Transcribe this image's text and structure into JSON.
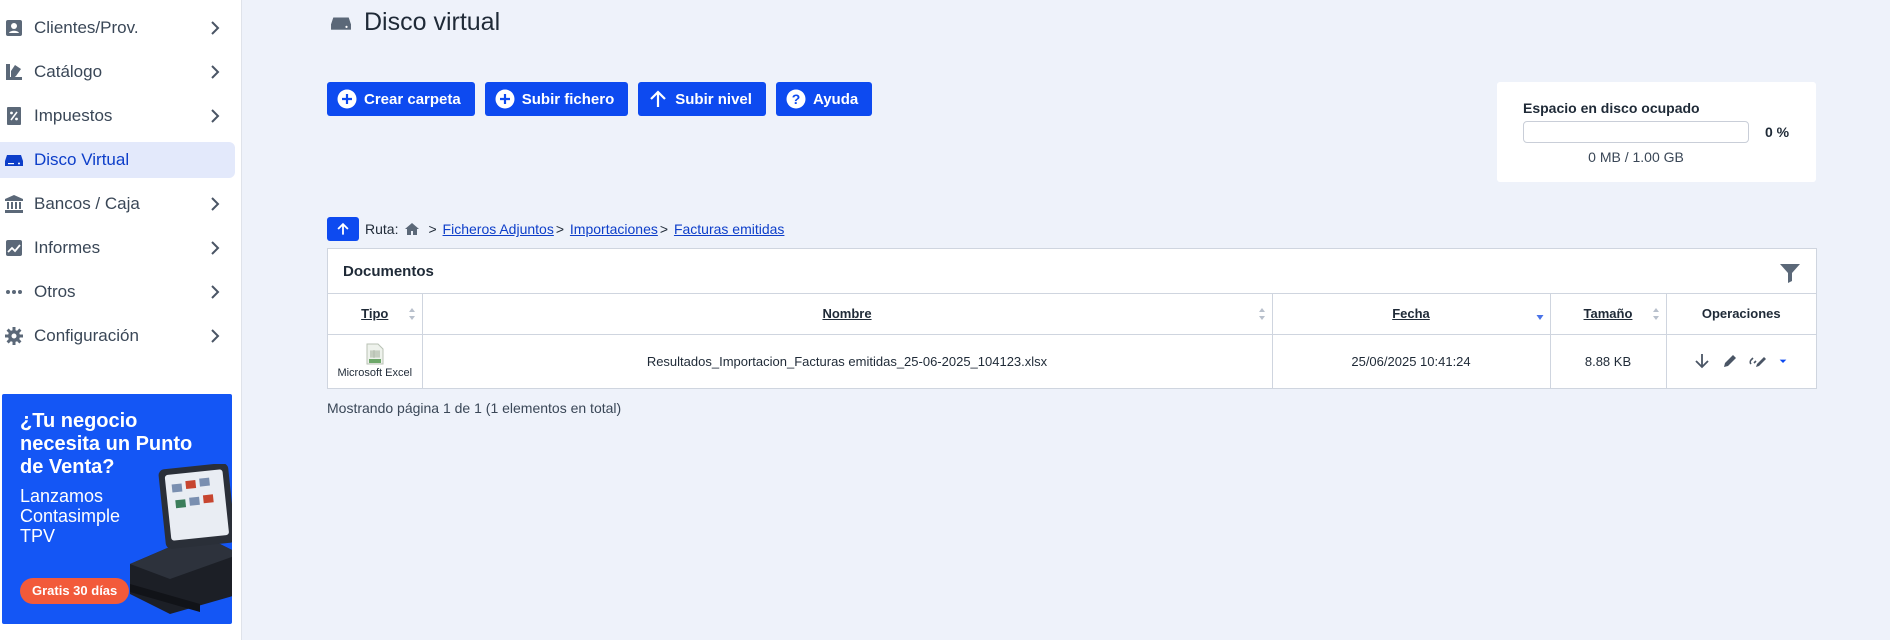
{
  "sidebar": {
    "items": [
      {
        "label": "Clientes/Prov.",
        "icon": "contact-card-icon"
      },
      {
        "label": "Catálogo",
        "icon": "catalog-icon"
      },
      {
        "label": "Impuestos",
        "icon": "percent-document-icon"
      },
      {
        "label": "Disco Virtual",
        "icon": "hard-drive-icon",
        "active": true
      },
      {
        "label": "Bancos / Caja",
        "icon": "bank-icon"
      },
      {
        "label": "Informes",
        "icon": "chart-report-icon"
      },
      {
        "label": "Otros",
        "icon": "more-dots-icon"
      },
      {
        "label": "Configuración",
        "icon": "gear-icon"
      }
    ],
    "promo": {
      "title": "¿Tu negocio necesita un Punto de Venta?",
      "subtitle": "Lanzamos Contasimple TPV",
      "cta": "Gratis 30 días"
    }
  },
  "page": {
    "title": "Disco virtual",
    "icon": "hard-drive-icon"
  },
  "toolbar": {
    "create_folder": "Crear carpeta",
    "upload_file": "Subir fichero",
    "level_up": "Subir nivel",
    "help": "Ayuda"
  },
  "disk": {
    "title": "Espacio en disco ocupado",
    "percent_label": "0 %",
    "fill_fraction": 0,
    "usage": "0 MB / 1.00 GB"
  },
  "route": {
    "label": "Ruta:",
    "separator": ">",
    "crumbs": [
      "Ficheros Adjuntos",
      "Importaciones",
      "Facturas emitidas"
    ]
  },
  "documents": {
    "title": "Documentos",
    "columns": {
      "type": "Tipo",
      "name": "Nombre",
      "date": "Fecha",
      "size": "Tamaño",
      "ops": "Operaciones"
    },
    "rows": [
      {
        "type": "Microsoft Excel",
        "name": "Resultados_Importacion_Facturas emitidas_25-06-2025_104123.xlsx",
        "date": "25/06/2025 10:41:24",
        "size": "8.88 KB"
      }
    ],
    "pager": "Mostrando página 1 de 1 (1 elementos en total)"
  },
  "colors": {
    "accent": "#0d4af0",
    "link": "#0d3ec9",
    "promo_bg": "#1456f5",
    "promo_cta": "#f25a3a",
    "background": "#eef2fa"
  }
}
